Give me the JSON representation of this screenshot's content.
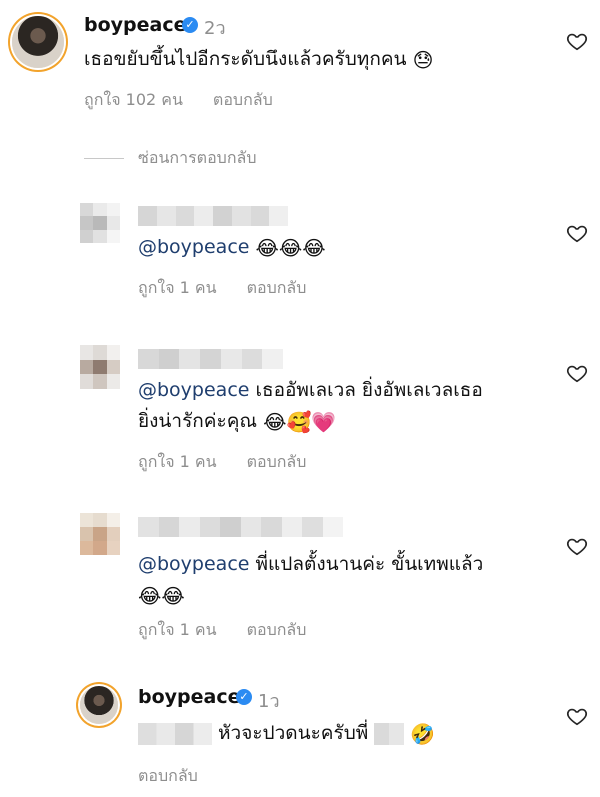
{
  "comments": [
    {
      "username": "boypeace",
      "time": "2ว",
      "text": "เธอขยับขึ้นไปอีกระดับนึงแล้วครับทุกคน",
      "emojis": [
        "😓"
      ],
      "likes": "ถูกใจ 102 คน",
      "reply_label": "ตอบกลับ"
    }
  ],
  "hide_replies_label": "ซ่อนการตอบกลับ",
  "replies": [
    {
      "mention": "@boypeace",
      "text": "",
      "emojis": [
        "😂",
        "😂",
        "😂"
      ],
      "likes": "ถูกใจ 1 คน",
      "reply_label": "ตอบกลับ"
    },
    {
      "mention": "@boypeace",
      "text_line1": "เธออัพเลเวล ยิ่งอัพเลเวลเธอ",
      "text_line2": "ยิ่งน่ารักค่ะคุณ",
      "emojis": [
        "😂",
        "🥰",
        "💗"
      ],
      "likes": "ถูกใจ 1 คน",
      "reply_label": "ตอบกลับ"
    },
    {
      "mention": "@boypeace",
      "text_line1": "พี่แปลตั้งนานค่ะ ขั้นเทพแล้ว",
      "emojis": [
        "😂",
        "😂"
      ],
      "likes": "ถูกใจ 1 คน",
      "reply_label": "ตอบกลับ"
    },
    {
      "username": "boypeace",
      "time": "1ว",
      "text": "หัวจะปวดนะครับพี่",
      "emojis": [
        "🤣"
      ],
      "reply_label": "ตอบกลับ"
    }
  ],
  "icons": {
    "verified": "verified-badge-icon",
    "heart": "heart-outline-icon"
  },
  "colors": {
    "mention": "#1f3e6e",
    "muted": "#8e8e8e",
    "verified": "#2b8bf2",
    "story_ring": "#f2a32c"
  }
}
